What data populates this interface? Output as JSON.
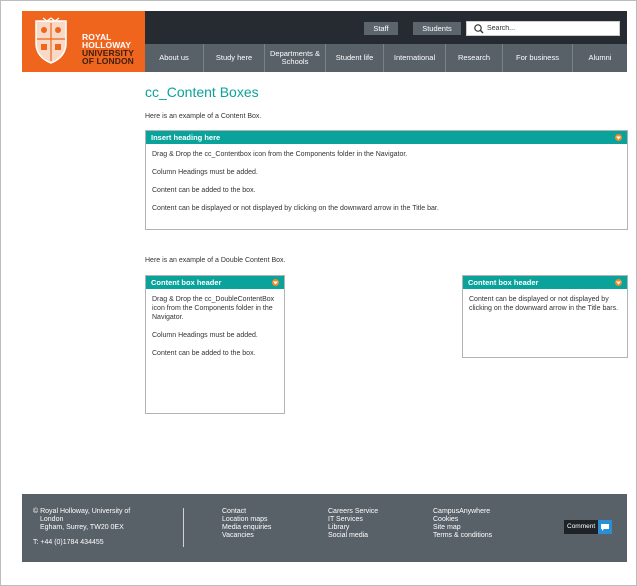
{
  "brand": {
    "line1": "ROYAL",
    "line2": "HOLLOWAY",
    "line3": "UNIVERSITY",
    "line4": "OF LONDON",
    "color": "#f0651e"
  },
  "topbar": {
    "staff_label": "Staff",
    "students_label": "Students",
    "search_placeholder": "Search..."
  },
  "nav": [
    {
      "label": "About us"
    },
    {
      "label": "Study here"
    },
    {
      "label": "Departments & Schools"
    },
    {
      "label": "Student life"
    },
    {
      "label": "International"
    },
    {
      "label": "Research"
    },
    {
      "label": "For business"
    },
    {
      "label": "Alumni"
    }
  ],
  "main": {
    "title": "cc_Content Boxes",
    "intro": "Here is an example of a Content Box.",
    "content_box": {
      "heading": "Insert heading here",
      "lines": [
        "Drag & Drop the cc_Contentbox icon from the Components folder in the Navigator.",
        "Column Headings must be added.",
        "Content can be added to the box.",
        "Content can be displayed or not displayed by clicking on the downward arrow in the Title bar."
      ]
    },
    "intro2": "Here is an example of a Double Content Box.",
    "double_left": {
      "heading": "Content box header",
      "lines": [
        "Drag & Drop the cc_DoubleContentBox icon from the Components folder in the Navigator.",
        "Column Headings must be added.",
        "Content can be added to the box."
      ]
    },
    "double_right": {
      "heading": "Content box header",
      "lines": [
        "Content can be displayed or not displayed by clicking on the downward arrow in the Title bars."
      ]
    }
  },
  "footer": {
    "address_line1": "© Royal Holloway, University of",
    "address_line2": "London",
    "address_line3": "Egham, Surrey, TW20 0EX",
    "phone": "T: +44 (0)1784 434455",
    "col1": [
      "Contact",
      "Location maps",
      "Media enquiries",
      "Vacancies"
    ],
    "col2": [
      "Careers Service",
      "IT Services",
      "Library",
      "Social media"
    ],
    "col3": [
      "CampusAnywhere",
      "Cookies",
      "Site map",
      "Terms & conditions"
    ],
    "comment_label": "Comment"
  },
  "colors": {
    "accent": "#0aa39c",
    "toggle": "#f5892a",
    "nav_bg": "#596168",
    "topbar_bg": "#262b31"
  }
}
